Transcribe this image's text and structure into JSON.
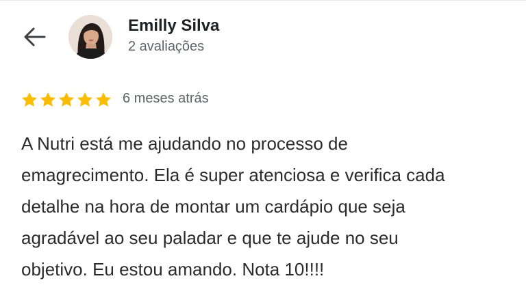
{
  "reviewer": {
    "name": "Emilly Silva",
    "review_count": "2 avaliações",
    "avatar_icon": "profile-photo"
  },
  "review": {
    "rating": 5,
    "max_rating": 5,
    "star_color": "#fbbc04",
    "date": "6 meses atrás",
    "text_lines": [
      "A Nutri está me ajudando no processo de",
      "emagrecimento. Ela é super atenciosa e verifica cada",
      "detalhe na hora de montar um cardápio que seja",
      "agradável ao seu paladar e que te ajude no seu",
      "objetivo. Eu estou amando. Nota 10!!!!"
    ]
  },
  "icons": {
    "back": "arrow-left-icon",
    "star": "star-icon"
  }
}
